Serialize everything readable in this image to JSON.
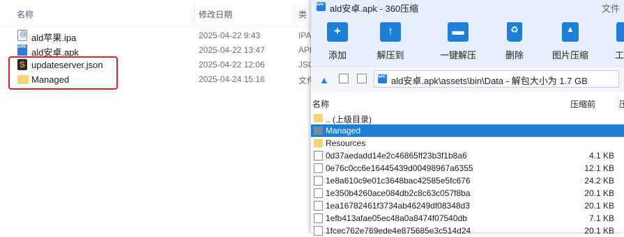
{
  "explorer": {
    "columns": {
      "name": "名称",
      "date": "修改日期",
      "type": "类"
    },
    "files": [
      {
        "name": "ald苹果.ipa",
        "date": "2025-04-22 9:43",
        "type": "IPA",
        "icon": "ipa-file-icon"
      },
      {
        "name": "ald安卓.apk",
        "date": "2025-04-22 13:47",
        "type": "APK",
        "icon": "apk-file-icon"
      },
      {
        "name": "updateserver.json",
        "date": "2025-04-22 12:06",
        "type": "JSO",
        "icon": "json-file-icon"
      },
      {
        "name": "Managed",
        "date": "2025-04-24 15:16",
        "type": "文件",
        "icon": "folder-icon"
      }
    ],
    "highlight_color": "#e02020"
  },
  "zip": {
    "title": "ald安卓.apk - 360压缩",
    "title_right": "文件",
    "toolbar": [
      {
        "label": "添加",
        "icon": "add-icon"
      },
      {
        "label": "解压到",
        "icon": "extract-to-icon"
      },
      {
        "label": "一键解压",
        "icon": "one-click-extract-icon"
      },
      {
        "label": "删除",
        "icon": "delete-icon"
      },
      {
        "label": "图片压缩",
        "icon": "image-compress-icon"
      },
      {
        "label": "工",
        "icon": "tools-icon"
      }
    ],
    "path": "ald安卓.apk\\assets\\bin\\Data - 解包大小为 1.7 GB",
    "columns": {
      "name": "名称",
      "size": "压缩前",
      "extra": "压"
    },
    "items": [
      {
        "name": ".. (上级目录)",
        "size": "",
        "kind": "folder"
      },
      {
        "name": "Managed",
        "size": "",
        "kind": "folder",
        "selected": true
      },
      {
        "name": "Resources",
        "size": "",
        "kind": "folder"
      },
      {
        "name": "0d37aedadd14e2c46865ff23b3f1b8a6",
        "size": "4.1 KB",
        "kind": "file"
      },
      {
        "name": "0e76c0cc6e16445439d00498967a6355",
        "size": "12.1 KB",
        "kind": "file"
      },
      {
        "name": "1e8a610c9e01c3648bac42585e5fc676",
        "size": "24.2 KB",
        "kind": "file"
      },
      {
        "name": "1e350b4260ace084db2c8c63c057f8ba",
        "size": "20.1 KB",
        "kind": "file"
      },
      {
        "name": "1ea16782461f3734ab46249df08348d3",
        "size": "20.1 KB",
        "kind": "file"
      },
      {
        "name": "1efb413afae05ec48a0a8474f07540db",
        "size": "7.1 KB",
        "kind": "file"
      },
      {
        "name": "1fcec762e769ede4e875685e3c514d24",
        "size": "20.1 KB",
        "kind": "file"
      }
    ],
    "accent": "#1e7fd9"
  }
}
